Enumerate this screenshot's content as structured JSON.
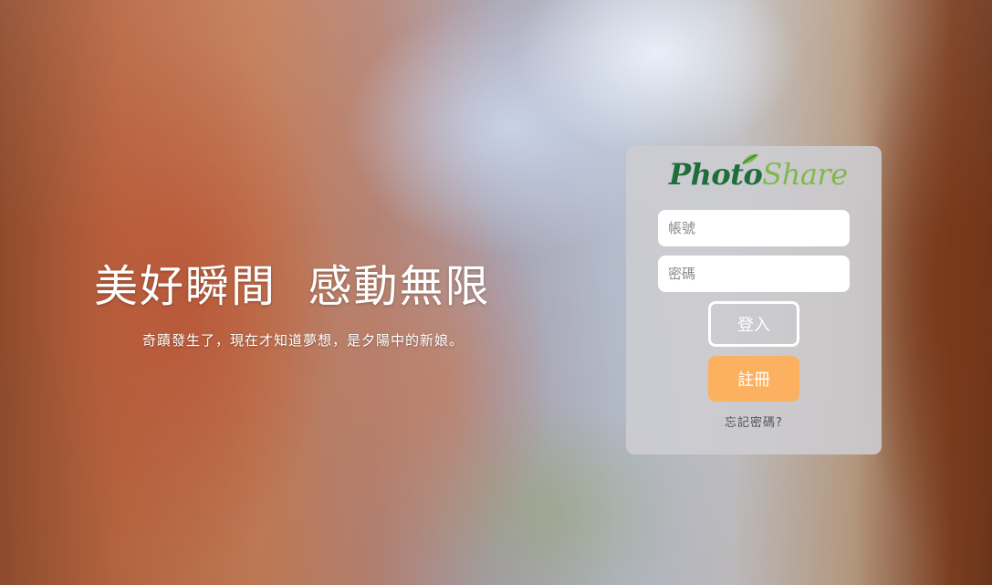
{
  "hero": {
    "title": "美好瞬間  感動無限",
    "subtitle": "奇蹟發生了，現在才知道夢想，是夕陽中的新娘。"
  },
  "login": {
    "logo_text_1": "Photo",
    "logo_text_2": "Share",
    "account_placeholder": "帳號",
    "account_value": "",
    "password_placeholder": "密碼",
    "password_value": "",
    "login_label": "登入",
    "register_label": "註冊",
    "forgot_label": "忘記密碼?"
  },
  "colors": {
    "register_button": "#fbb160",
    "logo_primary": "#1f6e3a",
    "logo_secondary": "#7fb84b",
    "panel": "#cdcdd2"
  },
  "icons": {
    "logo_leaf": "leaf-icon"
  }
}
